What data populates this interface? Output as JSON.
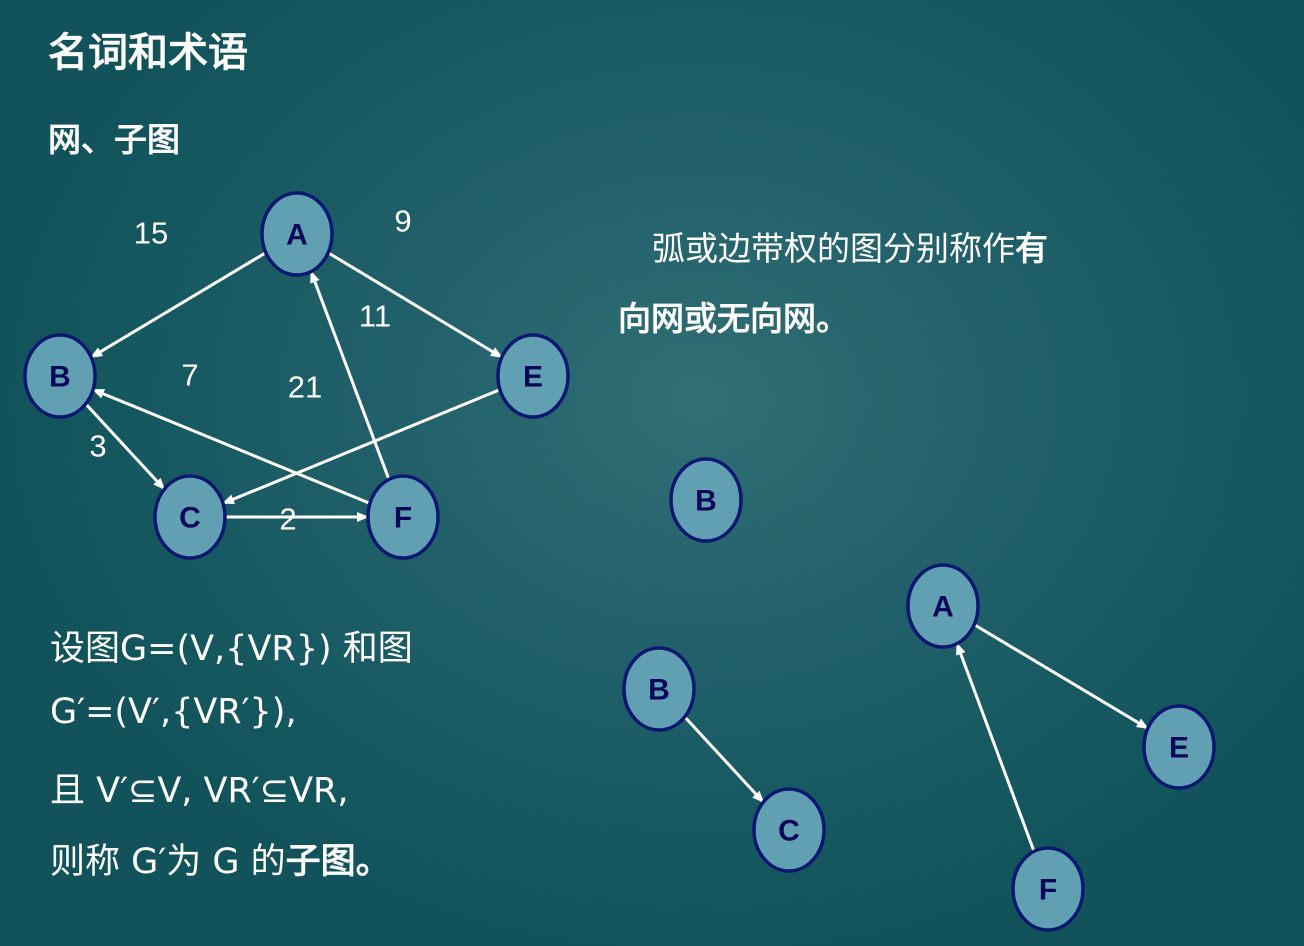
{
  "slide": {
    "title": "名词和术语",
    "subtitle": "网、子图",
    "right_text": {
      "line1_normal": "弧或边带权的图分别称作",
      "line1_bold": "有",
      "line2_bold": "向网或无向网。"
    },
    "left_text": {
      "line1": "设图G=(V,{VR}) 和图",
      "line2": "G′=(V′,{VR′}),",
      "line3": "且 V′⊆V, VR′⊆VR,",
      "line4_normal": "则称 G′为 G 的",
      "line4_bold": "子图。"
    }
  },
  "network": {
    "nodes": [
      "A",
      "B",
      "C",
      "E",
      "F"
    ],
    "edges": [
      {
        "from": "A",
        "to": "B",
        "weight": "15"
      },
      {
        "from": "A",
        "to": "E",
        "weight": "9"
      },
      {
        "from": "F",
        "to": "A",
        "weight": "11"
      },
      {
        "from": "F",
        "to": "B",
        "weight": "7"
      },
      {
        "from": "E",
        "to": "C",
        "weight": "21"
      },
      {
        "from": "B",
        "to": "C",
        "weight": "3"
      },
      {
        "from": "C",
        "to": "F",
        "weight": "2"
      }
    ]
  },
  "subgraphs": [
    {
      "nodes": [
        "B"
      ],
      "edges": []
    },
    {
      "nodes": [
        "A",
        "E",
        "F"
      ],
      "edges": [
        {
          "from": "A",
          "to": "E"
        },
        {
          "from": "F",
          "to": "A"
        }
      ]
    },
    {
      "nodes": [
        "B",
        "C"
      ],
      "edges": [
        {
          "from": "B",
          "to": "C"
        }
      ]
    }
  ],
  "colors": {
    "node_fill": "#61a0b3",
    "node_stroke": "#0b1870",
    "node_label": "#08085a",
    "edge": "#ffffff",
    "background": "#1a5a62"
  }
}
